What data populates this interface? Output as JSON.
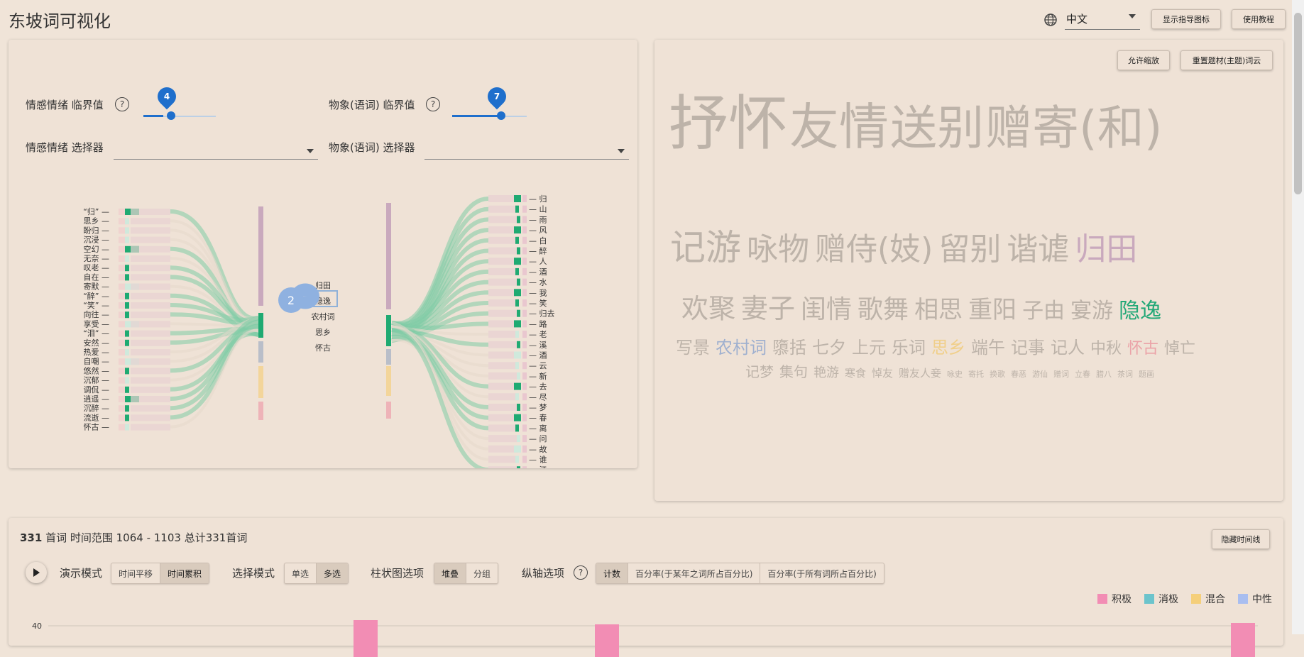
{
  "app": {
    "title": "东坡词可视化"
  },
  "header": {
    "language": "中文",
    "show_guide_button": "显示指导图标",
    "tutorial_button": "使用教程"
  },
  "left_panel": {
    "emotion_threshold_label": "情感情绪 临界值",
    "emotion_threshold_value": "4",
    "object_threshold_label": "物象(语词) 临界值",
    "object_threshold_value": "7",
    "emotion_selector_label": "情感情绪 选择器",
    "object_selector_label": "物象(语词) 选择器",
    "help_symbol": "?",
    "emotions": [
      "“归”",
      "思乡",
      "盼归",
      "沉浸",
      "空幻",
      "无奈",
      "叹老",
      "自在",
      "寄默",
      "“醉”",
      "“笑”",
      "向往",
      "享受",
      "“泪”",
      "安然",
      "热爱",
      "自嘲",
      "悠然",
      "沉郁",
      "调侃",
      "逍遥",
      "沉醉",
      "流逝",
      "怀古"
    ],
    "themes": [
      "归田",
      "隐逸",
      "农村词",
      "思乡",
      "怀古"
    ],
    "guide_badge": "2",
    "objects": [
      "归",
      "山",
      "雨",
      "风",
      "白",
      "醉",
      "人",
      "酒",
      "水",
      "我",
      "笑",
      "归去",
      "路",
      "老",
      "溪",
      "酒",
      "云",
      "新",
      "去",
      "尽",
      "梦",
      "春",
      "离",
      "问",
      "故",
      "谁",
      "江"
    ]
  },
  "word_cloud": {
    "zoom_button": "允许缩放",
    "reset_button": "重置题材(主题)词云",
    "lines": [
      [
        {
          "t": "抒怀",
          "c": "#bdb3a9",
          "s": 84
        },
        {
          "t": "友情",
          "c": "#bdb3a9",
          "s": 70
        },
        {
          "t": "送别",
          "c": "#bdb3a9",
          "s": 66
        },
        {
          "t": "赠寄(和)",
          "c": "#bdb3a9",
          "s": 66
        }
      ],
      [
        {
          "t": "记游",
          "c": "#bdb3a9",
          "s": 50
        },
        {
          "t": "咏物",
          "c": "#bdb3a9",
          "s": 44
        },
        {
          "t": "赠侍(妓)",
          "c": "#bdb3a9",
          "s": 44
        },
        {
          "t": "留别",
          "c": "#bdb3a9",
          "s": 44
        },
        {
          "t": "谐谑",
          "c": "#bdb3a9",
          "s": 44
        },
        {
          "t": "归田",
          "c": "#c9a9bd",
          "s": 44
        }
      ],
      [
        {
          "t": "欢聚",
          "c": "#bdb3a9",
          "s": 38
        },
        {
          "t": "妻子",
          "c": "#bdb3a9",
          "s": 38
        },
        {
          "t": "闺情",
          "c": "#bdb3a9",
          "s": 36
        },
        {
          "t": "歌舞",
          "c": "#bdb3a9",
          "s": 36
        },
        {
          "t": "相思",
          "c": "#bdb3a9",
          "s": 34
        },
        {
          "t": "重阳",
          "c": "#bdb3a9",
          "s": 34
        },
        {
          "t": "子由",
          "c": "#bdb3a9",
          "s": 30
        },
        {
          "t": "宴游",
          "c": "#bdb3a9",
          "s": 30
        },
        {
          "t": "隐逸",
          "c": "#22a877",
          "s": 30
        }
      ],
      [
        {
          "t": "写景",
          "c": "#bdb3a9",
          "s": 24
        },
        {
          "t": "农村词",
          "c": "#9fb0cf",
          "s": 24
        },
        {
          "t": "隳括",
          "c": "#bdb3a9",
          "s": 24
        },
        {
          "t": "七夕",
          "c": "#bdb3a9",
          "s": 24
        },
        {
          "t": "上元",
          "c": "#bdb3a9",
          "s": 24
        },
        {
          "t": "乐词",
          "c": "#bdb3a9",
          "s": 24
        },
        {
          "t": "思乡",
          "c": "#f0cf8a",
          "s": 24
        },
        {
          "t": "端午",
          "c": "#bdb3a9",
          "s": 24
        },
        {
          "t": "记事",
          "c": "#bdb3a9",
          "s": 24
        },
        {
          "t": "记人",
          "c": "#bdb3a9",
          "s": 24
        },
        {
          "t": "中秋",
          "c": "#bdb3a9",
          "s": 22
        },
        {
          "t": "怀古",
          "c": "#eba3a8",
          "s": 22
        },
        {
          "t": "悼亡",
          "c": "#bdb3a9",
          "s": 22
        }
      ],
      [
        {
          "t": "记梦",
          "c": "#bdb3a9",
          "s": 20
        },
        {
          "t": "集句",
          "c": "#bdb3a9",
          "s": 20
        },
        {
          "t": "艳游",
          "c": "#bdb3a9",
          "s": 18
        },
        {
          "t": "寒食",
          "c": "#bdb3a9",
          "s": 15
        },
        {
          "t": "悼友",
          "c": "#bdb3a9",
          "s": 15
        },
        {
          "t": "赠友人妾",
          "c": "#bdb3a9",
          "s": 15
        },
        {
          "t": "咏史",
          "c": "#bdb3a9",
          "s": 11
        },
        {
          "t": "寄托",
          "c": "#bdb3a9",
          "s": 11
        },
        {
          "t": "换歌",
          "c": "#bdb3a9",
          "s": 11
        },
        {
          "t": "春恶",
          "c": "#bdb3a9",
          "s": 11
        },
        {
          "t": "游仙",
          "c": "#bdb3a9",
          "s": 11
        },
        {
          "t": "赠词",
          "c": "#bdb3a9",
          "s": 11
        },
        {
          "t": "立春",
          "c": "#bdb3a9",
          "s": 11
        },
        {
          "t": "腊八",
          "c": "#bdb3a9",
          "s": 11
        },
        {
          "t": "茶词",
          "c": "#bdb3a9",
          "s": 11
        },
        {
          "t": "题画",
          "c": "#bdb3a9",
          "s": 11
        }
      ]
    ]
  },
  "timeline": {
    "count": "331",
    "summary": "首词 时间范围 1064 - 1103 总计331首词",
    "hide_button": "隐藏时间线",
    "demo_mode_label": "演示模式",
    "demo_modes": [
      "时间平移",
      "时间累积"
    ],
    "select_mode_label": "选择模式",
    "select_modes": [
      "单选",
      "多选"
    ],
    "bar_option_label": "柱状图选项",
    "bar_options": [
      "堆叠",
      "分组"
    ],
    "y_option_label": "纵轴选项",
    "y_options": [
      "计数",
      "百分率(于某年之词所占百分比)",
      "百分率(于所有词所占百分比)"
    ],
    "legend": [
      {
        "name": "积极",
        "color": "#f28db4"
      },
      {
        "name": "消极",
        "color": "#6cc4cc"
      },
      {
        "name": "混合",
        "color": "#f5cf7a"
      },
      {
        "name": "中性",
        "color": "#a9bef0"
      }
    ],
    "y_tick": "40",
    "y_max": 40
  }
}
